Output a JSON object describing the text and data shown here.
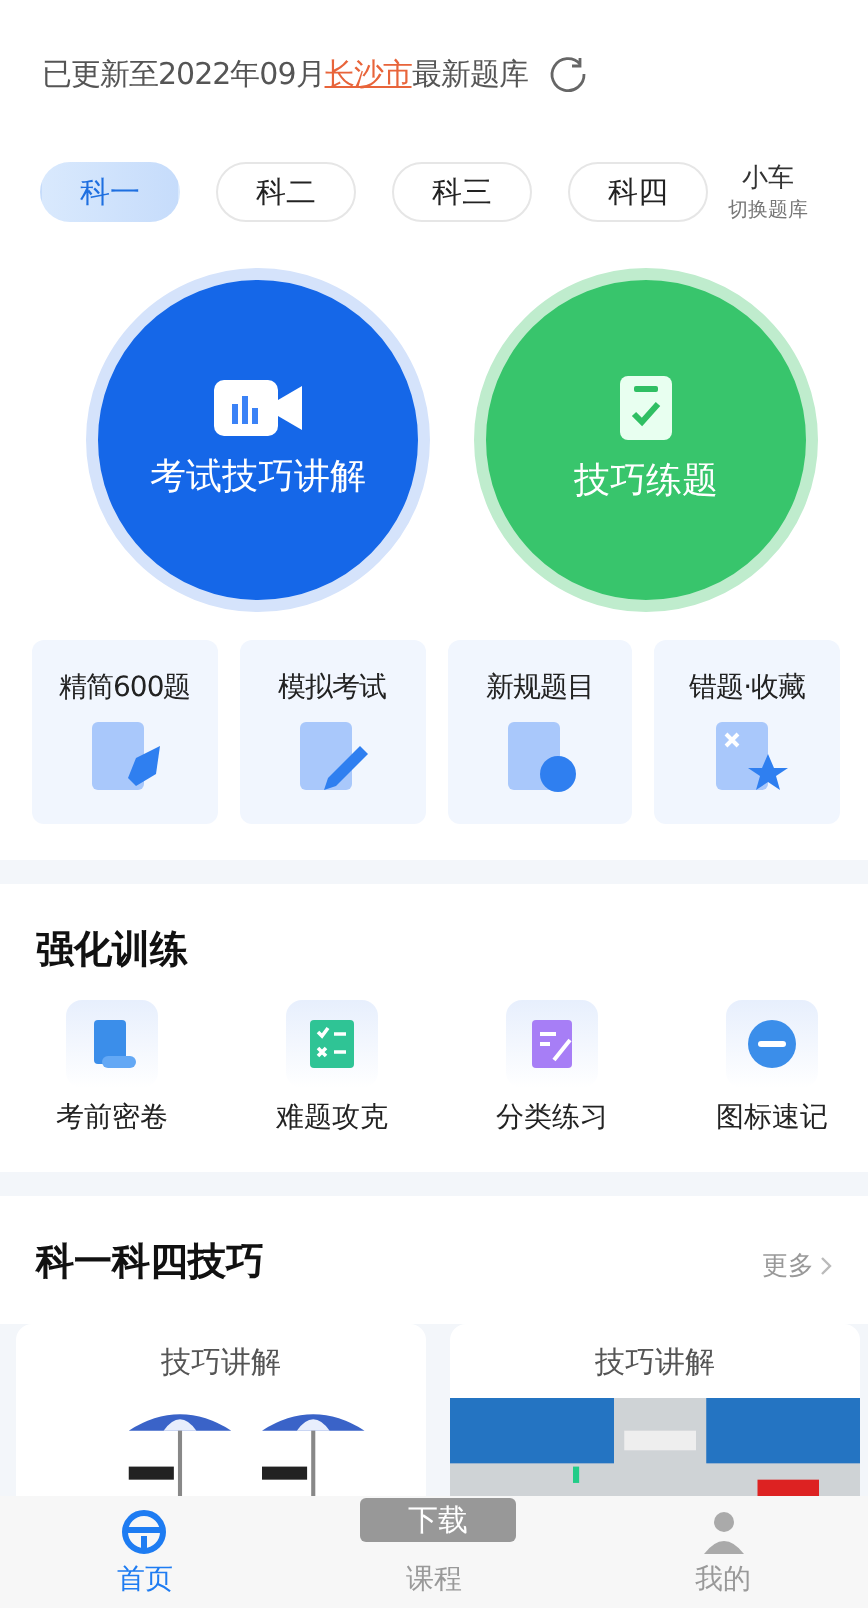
{
  "update_notice": {
    "before": "已更新至2022年09月",
    "city": "长沙市",
    "after": "最新题库"
  },
  "subjects": [
    {
      "label": "科一",
      "selected": true
    },
    {
      "label": "科二",
      "selected": false
    },
    {
      "label": "科三",
      "selected": false
    },
    {
      "label": "科四",
      "selected": false
    }
  ],
  "bank_switch": {
    "vehicle": "小车",
    "hint": "切换题库"
  },
  "hero_buttons": [
    {
      "kind": "video",
      "label": "考试技巧讲解"
    },
    {
      "kind": "practice",
      "label": "技巧练题"
    }
  ],
  "quick_cards": [
    {
      "kind": "rocket",
      "label": "精简600题"
    },
    {
      "kind": "pencil",
      "label": "模拟考试"
    },
    {
      "kind": "new",
      "label": "新规题目"
    },
    {
      "kind": "star",
      "label": "错题·收藏"
    }
  ],
  "training": {
    "title": "强化训练",
    "items": [
      {
        "kind": "scroll",
        "label": "考前密卷"
      },
      {
        "kind": "checklist",
        "label": "难题攻克"
      },
      {
        "kind": "edit",
        "label": "分类练习"
      },
      {
        "kind": "sign",
        "label": "图标速记"
      }
    ]
  },
  "tips": {
    "title": "科一科四技巧",
    "more": "更多",
    "cards": [
      {
        "kind": "umbrella",
        "label": "技巧讲解"
      },
      {
        "kind": "road",
        "label": "技巧讲解"
      }
    ]
  },
  "toast": "下载",
  "nav": [
    {
      "kind": "wheel",
      "label": "首页",
      "selected": true
    },
    {
      "kind": "video",
      "label": "课程",
      "selected": false
    },
    {
      "kind": "person",
      "label": "我的",
      "selected": false
    }
  ]
}
